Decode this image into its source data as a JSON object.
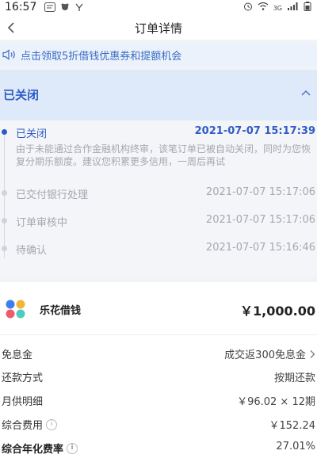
{
  "status_bar": {
    "time": "16:57",
    "left_icons": [
      "message-icon",
      "notification-icon",
      "app-icon"
    ],
    "network_label": "3G",
    "battery_icon": "battery-icon"
  },
  "nav": {
    "back_icon": "chevron-left-icon",
    "title": "订单详情"
  },
  "promo": {
    "icon": "speaker-icon",
    "text": "点击领取5折借钱优惠券和提额机会"
  },
  "order_status": {
    "title": "已关闭",
    "toggle_icon": "chevron-up-icon"
  },
  "timeline": [
    {
      "title": "已关闭",
      "time": "2021-07-07 15:17:39",
      "description": "由于未能通过合作金融机构终审，该笔订单已被自动关闭，同时为您恢复分期乐额度。建议您积累更多信用，一周后再试",
      "active": true
    },
    {
      "title": "已交付银行处理",
      "time": "2021-07-07 15:17:06",
      "active": false
    },
    {
      "title": "订单审核中",
      "time": "2021-07-07 15:17:06",
      "active": false
    },
    {
      "title": "待确认",
      "time": "2021-07-07 15:16:46",
      "active": false
    }
  ],
  "product": {
    "logo_icon": "lehua-logo-icon",
    "name": "乐花借钱",
    "amount": "￥1,000.00"
  },
  "details": {
    "interest_free": {
      "label": "免息金",
      "value": "成交返300免息金"
    },
    "repayment": {
      "label": "还款方式",
      "value": "按期还款"
    },
    "monthly": {
      "label": "月供明细",
      "value": "￥96.02 × 12期"
    },
    "total_fee": {
      "label": "综合费用",
      "value": "￥152.24"
    },
    "annual_rate": {
      "label": "综合年化费率",
      "value": "27.01%"
    }
  },
  "colors": {
    "accent": "#2e5cc6",
    "status_bg": "#deeaf9",
    "promo_bg": "#ecf2fb",
    "muted_text": "#a4a8b0"
  }
}
